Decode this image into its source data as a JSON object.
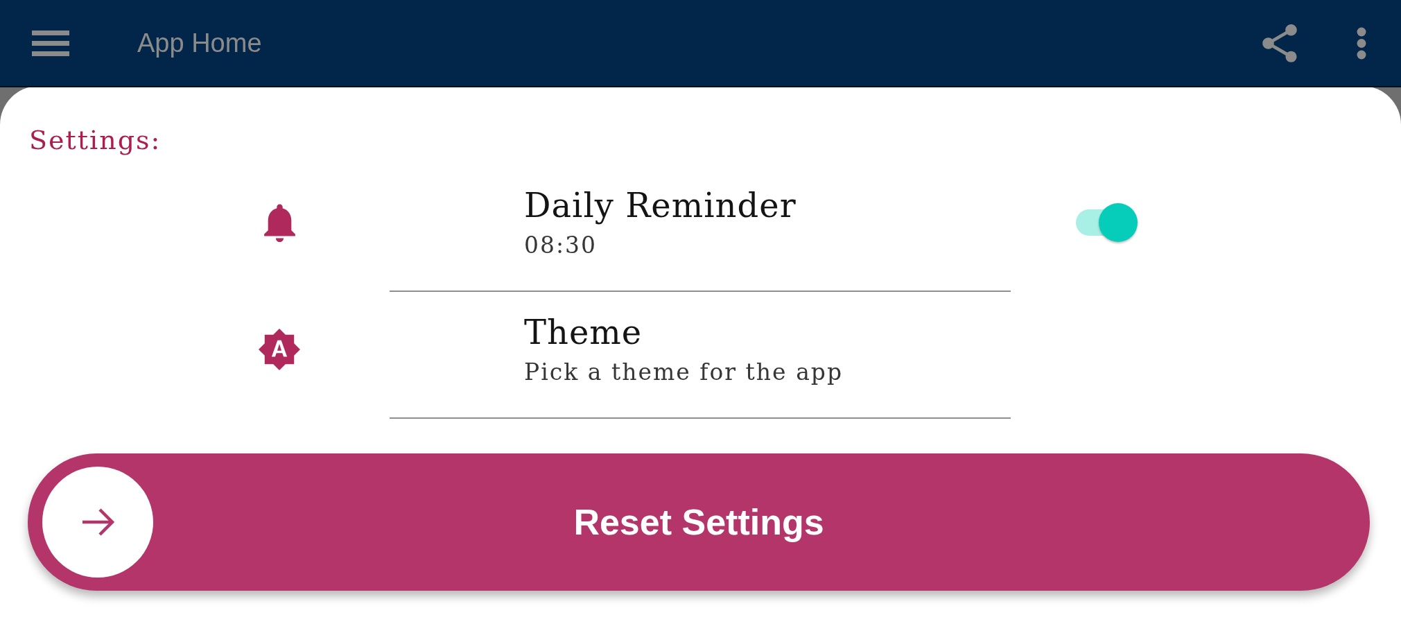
{
  "app_bar": {
    "title": "App Home"
  },
  "settings": {
    "heading": "Settings:",
    "items": [
      {
        "kind": "switch",
        "title": "Daily Reminder",
        "subtitle": "08:30",
        "on": true
      },
      {
        "kind": "text",
        "title": "Theme",
        "subtitle": "Pick a theme for the app"
      }
    ]
  },
  "reset_button": {
    "label": "Reset Settings"
  }
}
